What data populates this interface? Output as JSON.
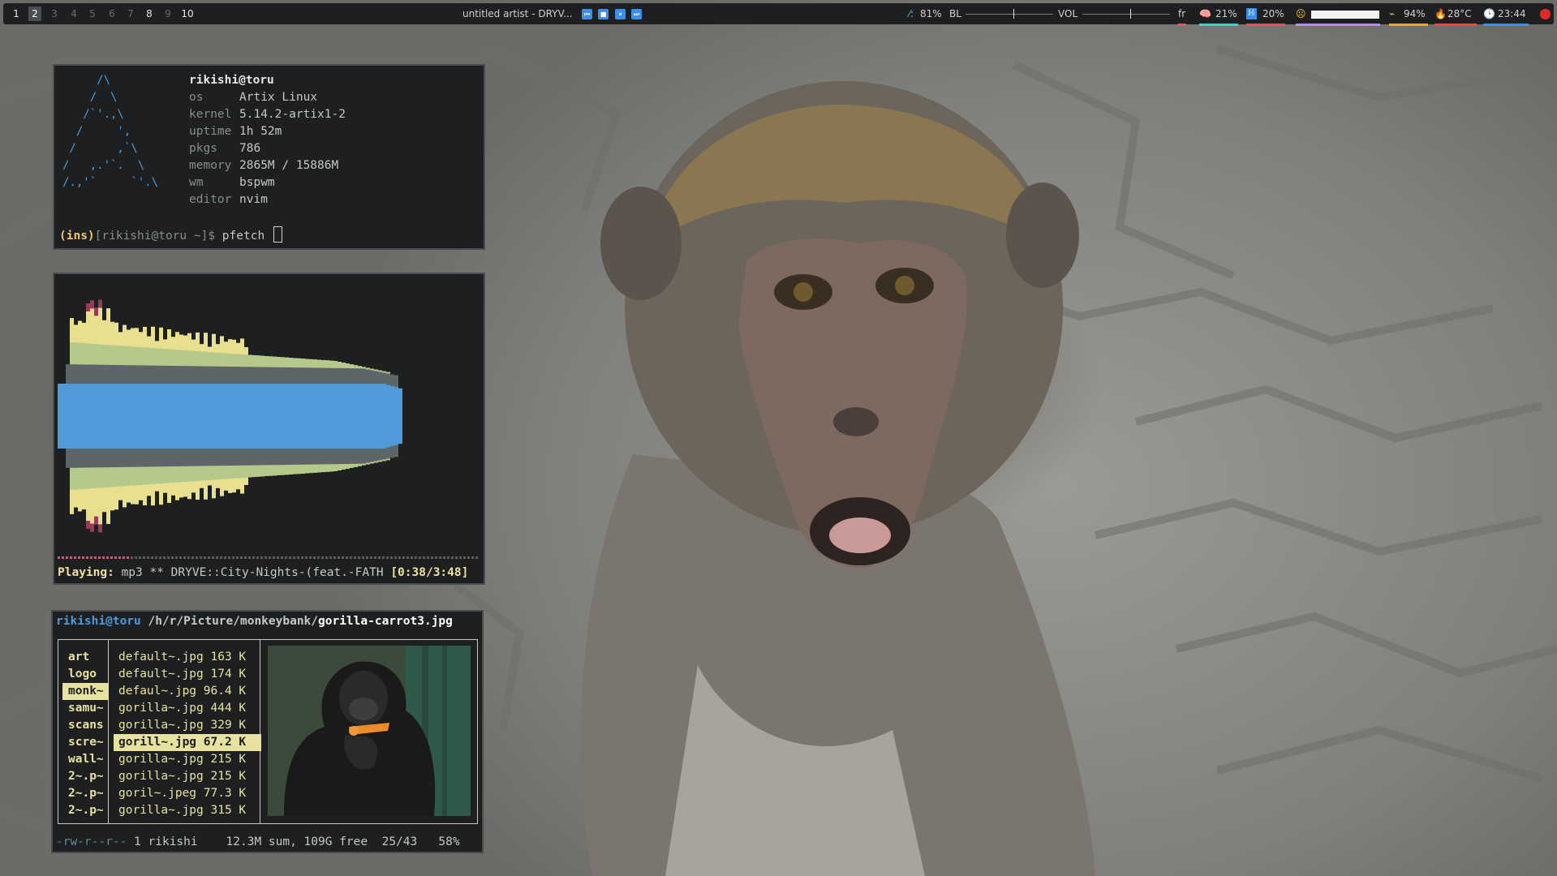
{
  "topbar": {
    "workspaces": [
      {
        "label": "1",
        "state": "occupied"
      },
      {
        "label": "2",
        "state": "focused"
      },
      {
        "label": "3",
        "state": "empty"
      },
      {
        "label": "4",
        "state": "empty"
      },
      {
        "label": "5",
        "state": "empty"
      },
      {
        "label": "6",
        "state": "empty"
      },
      {
        "label": "7",
        "state": "empty"
      },
      {
        "label": "8",
        "state": "occupied"
      },
      {
        "label": "9",
        "state": "empty"
      },
      {
        "label": "10",
        "state": "occupied"
      }
    ],
    "now_playing": "untitled artist - DRYV...",
    "media_buttons": {
      "prev": "⏮",
      "stop": "■",
      "pause": "⏸",
      "next": "⏭"
    },
    "brightness_percent": "81%",
    "brightness_label": "BL",
    "brightness_level": 0.55,
    "volume_label": "VOL",
    "volume_level": 0.55,
    "keyboard_layout": "fr",
    "cpu": "21%",
    "ram": "20%",
    "battery": "94%",
    "temperature": "28°C",
    "clock": "23:44",
    "colors": {
      "accent": "#f0a53b",
      "cpu_underline": "#e4506a",
      "ram_underline": "#3fd0c9",
      "net_underline": "#b48cf0",
      "battery_underline": "#f0a53b",
      "temp_underline": "#e0503c",
      "clock_underline": "#3d8ee8"
    }
  },
  "pfetch": {
    "user_host": "rikishi@toru",
    "rows": [
      {
        "key": "os",
        "value": "Artix Linux"
      },
      {
        "key": "kernel",
        "value": "5.14.2-artix1-2"
      },
      {
        "key": "uptime",
        "value": "1h 52m"
      },
      {
        "key": "pkgs",
        "value": "786"
      },
      {
        "key": "memory",
        "value": "2865M / 15886M"
      },
      {
        "key": "wm",
        "value": "bspwm"
      },
      {
        "key": "editor",
        "value": "nvim"
      }
    ],
    "prompt_mode": "(ins)",
    "prompt_body": "[rikishi@toru ~]$",
    "command": "pfetch",
    "logo_lines": [
      "     /\\",
      "    /  \\",
      "   /`'.,\\",
      "  /     ',",
      " /      ,`\\",
      "/   ,.'`.  \\",
      "/.,'`     `'.\\"
    ]
  },
  "visualizer": {
    "status_label": "Playing:",
    "status_text": " mp3 ** DRYVE::City-Nights-(feat.-FATH ",
    "status_time": "[0:38/3:48]",
    "progress": 0.175,
    "colors": {
      "peak": "#9a3a5a",
      "outer": "#e8df8f",
      "mid": "#b5c98a",
      "inner": "#5c6669",
      "core": "#4f9bd9"
    }
  },
  "ranger": {
    "user_host": "rikishi@toru",
    "path": " /h/r/Picture/monkeybank/",
    "file": "gorilla-carrot3.jpg",
    "dirs": [
      "art",
      "logo",
      "monk~",
      "samu~",
      "scans",
      "scre~",
      "wall~",
      "2~.p~",
      "2~.p~",
      "2~.p~"
    ],
    "selected_dir": 2,
    "files": [
      "default~.jpg 163 K",
      "default~.jpg 174 K",
      "defaul~.jpg 96.4 K",
      "gorilla~.jpg 444 K",
      "gorilla~.jpg 329 K",
      "gorill~.jpg 67.2 K",
      "gorilla~.jpg 215 K",
      "gorilla~.jpg 215 K",
      "goril~.jpeg 77.3 K",
      "gorilla~.jpg 315 K"
    ],
    "selected_file": 5,
    "perms": "-rw-r--r--",
    "status_rest": " 1 rikishi    12.3M sum, 109G free  25/43   58%"
  }
}
